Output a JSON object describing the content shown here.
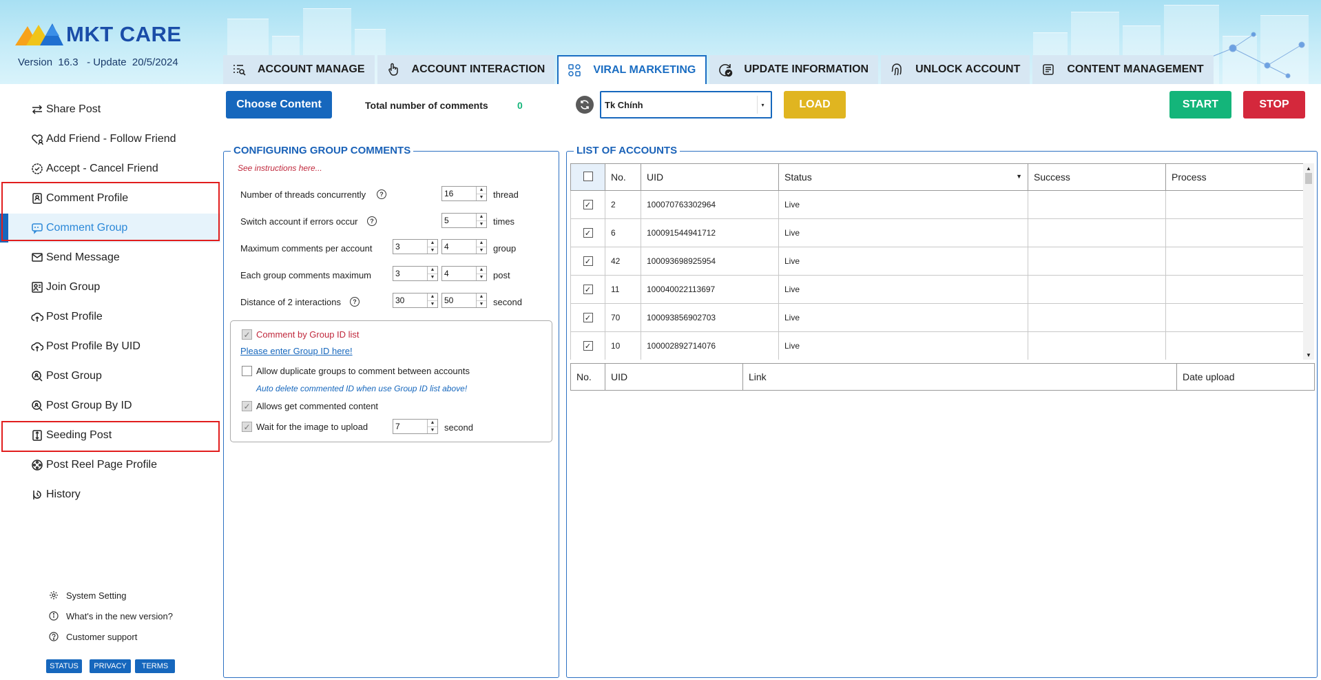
{
  "app": {
    "brand": "MKT CARE",
    "version_line": "Version  16.3   - Update  20/5/2024"
  },
  "tabs": [
    {
      "label": "ACCOUNT MANAGE",
      "icon": "list-search-icon"
    },
    {
      "label": "ACCOUNT INTERACTION",
      "icon": "hand-pointer-icon"
    },
    {
      "label": "VIRAL MARKETING",
      "icon": "nodes-icon",
      "active": true
    },
    {
      "label": "UPDATE INFORMATION",
      "icon": "refresh-check-icon"
    },
    {
      "label": "UNLOCK ACCOUNT",
      "icon": "fingerprint-icon"
    },
    {
      "label": "CONTENT MANAGEMENT",
      "icon": "document-lines-icon"
    }
  ],
  "sidebar": {
    "items": [
      {
        "label": "Share Post",
        "icon": "share-arrows-icon"
      },
      {
        "label": "Add Friend - Follow Friend",
        "icon": "heart-user-icon"
      },
      {
        "label": "Accept - Cancel Friend",
        "icon": "check-circle-icon"
      },
      {
        "label": "Comment Profile",
        "icon": "profile-card-icon"
      },
      {
        "label": "Comment Group",
        "icon": "comment-icon",
        "active": true
      },
      {
        "label": "Send Message",
        "icon": "envelope-icon"
      },
      {
        "label": "Join Group",
        "icon": "group-image-icon"
      },
      {
        "label": "Post Profile",
        "icon": "cloud-upload-icon"
      },
      {
        "label": "Post Profile By UID",
        "icon": "cloud-upload-icon"
      },
      {
        "label": "Post Group",
        "icon": "search-group-icon"
      },
      {
        "label": "Post Group By ID",
        "icon": "search-group-icon"
      },
      {
        "label": "Seeding Post",
        "icon": "sort-box-icon"
      },
      {
        "label": "Post Reel Page Profile",
        "icon": "reel-icon"
      },
      {
        "label": "History",
        "icon": "history-icon"
      }
    ],
    "bottom_links": [
      {
        "label": "System Setting",
        "icon": "gear-icon"
      },
      {
        "label": "What's in the new version?",
        "icon": "info-icon"
      },
      {
        "label": "Customer support",
        "icon": "help-icon"
      }
    ],
    "pills": [
      "STATUS",
      "PRIVACY",
      "TERMS"
    ]
  },
  "toolbar": {
    "choose_content": "Choose Content",
    "total_label": "Total number of comments",
    "total_value": "0",
    "account_select": "Tk Chính",
    "load": "LOAD",
    "start": "START",
    "stop": "STOP",
    "colors": {
      "choose": "#1667bd",
      "load": "#e0b520",
      "start": "#14b57a",
      "stop": "#d4283c"
    }
  },
  "config": {
    "title": "CONFIGURING GROUP COMMENTS",
    "instructions": "See instructions here...",
    "rows": [
      {
        "label": "Number of threads concurrently",
        "values": [
          "16"
        ],
        "unit": "thread",
        "help": true
      },
      {
        "label": "Switch account if errors occur",
        "values": [
          "5"
        ],
        "unit": "times",
        "help": true
      },
      {
        "label": "Maximum comments per account",
        "values": [
          "3",
          "4"
        ],
        "unit": "group",
        "help": false
      },
      {
        "label": "Each group comments maximum",
        "values": [
          "3",
          "4"
        ],
        "unit": "post",
        "help": false
      },
      {
        "label": "Distance of 2 interactions",
        "values": [
          "30",
          "50"
        ],
        "unit": "second",
        "help": true
      }
    ],
    "options": {
      "by_group_id": "Comment by Group ID list",
      "enter_group_link": "Please enter Group ID here!",
      "allow_duplicate": "Allow duplicate groups to comment between accounts",
      "auto_delete_note": "Auto delete commented ID when use Group ID list above!",
      "allows_get": "Allows get commented content",
      "wait_image": "Wait for the image to upload",
      "wait_value": "7",
      "wait_unit": "second"
    }
  },
  "accounts": {
    "title": "LIST OF ACCOUNTS",
    "headers": [
      "No.",
      "UID",
      "Status",
      "Success",
      "Process"
    ],
    "rows": [
      {
        "no": "2",
        "uid": "100070763302964",
        "status": "Live"
      },
      {
        "no": "6",
        "uid": "100091544941712",
        "status": "Live"
      },
      {
        "no": "42",
        "uid": "100093698925954",
        "status": "Live"
      },
      {
        "no": "11",
        "uid": "100040022113697",
        "status": "Live"
      },
      {
        "no": "70",
        "uid": "100093856902703",
        "status": "Live"
      },
      {
        "no": "10",
        "uid": "100002892714076",
        "status": "Live"
      }
    ],
    "log_headers": [
      "No.",
      "UID",
      "Link",
      "Date upload"
    ]
  }
}
